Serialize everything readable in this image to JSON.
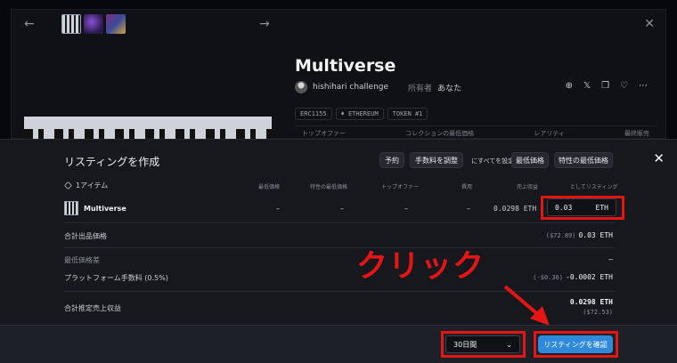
{
  "background": {
    "nft_title": "Multiverse",
    "owner_name": "hishihari challenge",
    "owner_label": "所有者",
    "owner_value": "あなた",
    "tags": [
      "ERC1155",
      "♦ ETHEREUM",
      "TOKEN #1"
    ],
    "attr_headers": [
      "トップオファー",
      "コレクションの最低価格",
      "レアリティ",
      "最終販売"
    ],
    "icons": [
      "globe-icon",
      "x-logo-icon",
      "copy-icon",
      "heart-icon",
      "more-icon"
    ]
  },
  "modal": {
    "title": "リスティングを作成",
    "quick_buttons": {
      "reserve": "予約",
      "adjust_fee": "手数料を調整",
      "set_all_label": "にすべてを設定",
      "floor": "最低価格",
      "trait_floor": "特性の最低価格"
    },
    "item_count": "1アイテム",
    "columns": [
      "最低価格",
      "特性の最低価格",
      "トップオファー",
      "費用",
      "売上収益",
      "としてリスティング"
    ],
    "row": {
      "name": "Multiverse",
      "floor": "–",
      "trait_floor": "–",
      "top_offer": "–",
      "cost": "–",
      "proceeds": "0.0298 ETH",
      "price_value": "0.03",
      "price_unit": "ETH"
    },
    "total_price": {
      "label": "合計出品価格",
      "usd": "($72.89)",
      "value": "0.03 ETH"
    },
    "floor_diff": {
      "label": "最低価格差",
      "value": "–"
    },
    "platform_fee": {
      "label": "プラットフォーム手数料 (0.5%)",
      "usd": "(-$0.36)",
      "value": "-0.0002 ETH"
    },
    "estimated_proceeds": {
      "label": "合計推定売上収益",
      "value": "0.0298 ETH",
      "usd": "($72.53)"
    },
    "footer": {
      "duration": "30日間",
      "confirm_button": "リスティングを確認"
    }
  },
  "annotation": {
    "text": "クリック",
    "color": "#e51515"
  }
}
